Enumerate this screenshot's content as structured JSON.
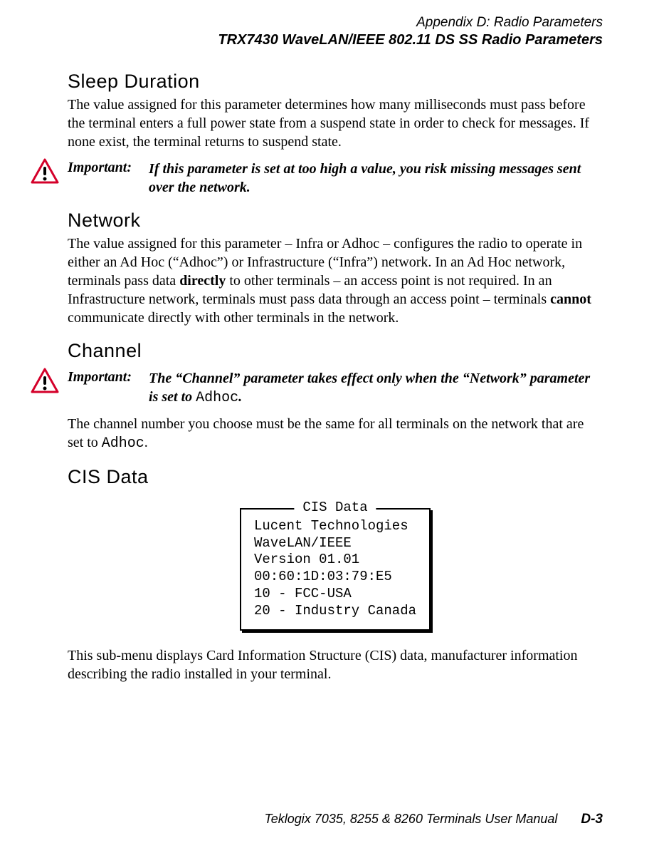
{
  "header": {
    "appendix": "Appendix  D:  Radio Parameters",
    "section": "TRX7430 WaveLAN/IEEE 802.11 DS SS Radio Parameters"
  },
  "sleep": {
    "heading": "Sleep Duration",
    "body": "The value assigned for this parameter determines how many milliseconds must pass before the terminal enters a full power state from a suspend state in order to check for messages. If none exist, the terminal returns to suspend state.",
    "important_label": "Important:",
    "important_text": "If this parameter is set at too high a value, you risk missing messages sent over the network."
  },
  "network": {
    "heading": "Network",
    "body_pre": "The value assigned for this parameter – Infra or Adhoc – configures the radio to operate in either an Ad Hoc (“Adhoc”) or Infrastructure (“Infra”) network. In an Ad Hoc network, terminals pass data ",
    "bold1": "directly",
    "body_mid": " to other terminals – an access point is not required. In an Infrastructure network, terminals must pass data through an access point – terminals ",
    "bold2": "cannot",
    "body_post": " communicate directly with other terminals in the network."
  },
  "channel": {
    "heading": "Channel",
    "important_label": "Important:",
    "important_pre": "The “Channel” parameter takes effect only when the “Network” parameter is set to ",
    "important_code": "Adhoc",
    "important_post": ".",
    "body_pre": "The channel number you choose must be the same for all terminals on the network that are set to ",
    "body_code": "Adhoc",
    "body_post": "."
  },
  "cis": {
    "heading": "CIS Data",
    "legend": "CIS Data",
    "lines": [
      "Lucent Technologies",
      "WaveLAN/IEEE",
      "Version 01.01",
      "00:60:1D:03:79:E5",
      "10 - FCC-USA",
      "20 - Industry Canada"
    ],
    "body": "This sub-menu displays Card Information Structure (CIS) data, manufacturer information describing the radio installed in your terminal."
  },
  "footer": {
    "manual": "Teklogix 7035, 8255 & 8260 Terminals User Manual",
    "page": "D-3"
  }
}
